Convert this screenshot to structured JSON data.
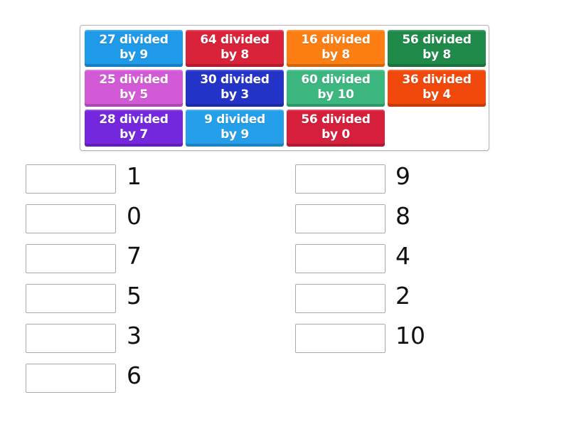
{
  "tiles": [
    {
      "line1": "27 divided",
      "line2": "by 9",
      "color": "#1f9ae8"
    },
    {
      "line1": "64 divided",
      "line2": "by 8",
      "color": "#d8233a"
    },
    {
      "line1": "16 divided",
      "line2": "by 8",
      "color": "#fd7e12"
    },
    {
      "line1": "56 divided",
      "line2": "by 8",
      "color": "#1f8a4a"
    },
    {
      "line1": "25 divided",
      "line2": "by 5",
      "color": "#d35ad7"
    },
    {
      "line1": "30 divided",
      "line2": "by 3",
      "color": "#2434c9"
    },
    {
      "line1": "60 divided",
      "line2": "by 10",
      "color": "#3cb77f"
    },
    {
      "line1": "36 divided",
      "line2": "by 4",
      "color": "#f1480b"
    },
    {
      "line1": "28 divided",
      "line2": "by 7",
      "color": "#7427dd"
    },
    {
      "line1": "9 divided",
      "line2": "by 9",
      "color": "#259fea"
    },
    {
      "line1": "56 divided",
      "line2": "by 0",
      "color": "#d51f3b"
    }
  ],
  "answers": {
    "left": [
      "1",
      "0",
      "7",
      "5",
      "3",
      "6"
    ],
    "right": [
      "9",
      "8",
      "4",
      "2",
      "10"
    ]
  }
}
